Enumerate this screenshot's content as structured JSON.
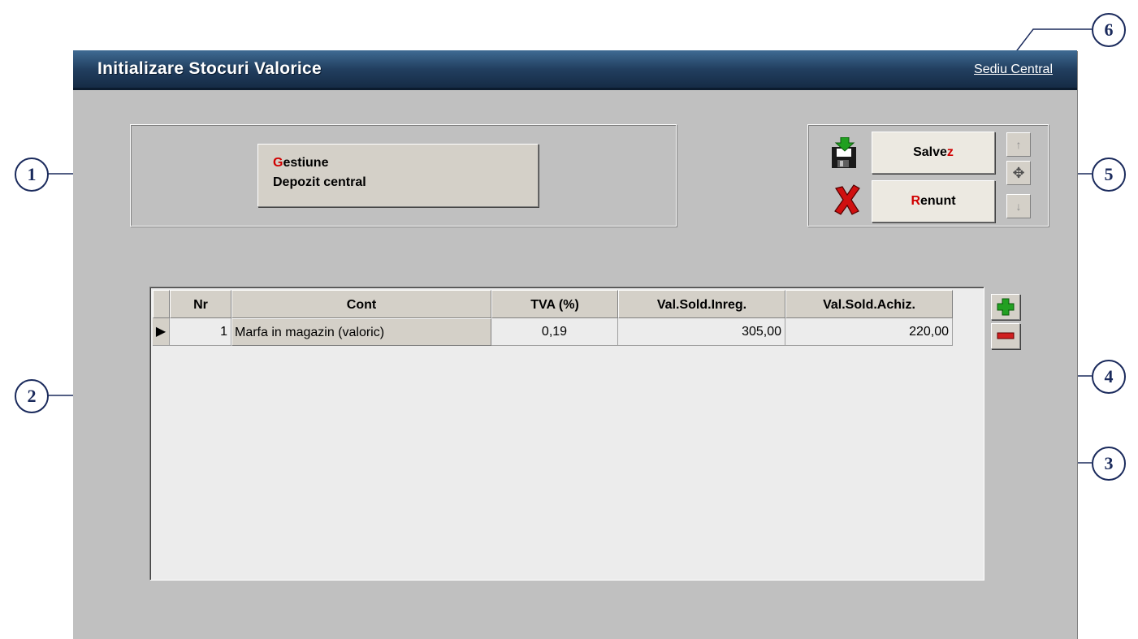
{
  "window": {
    "title": "Initializare Stocuri Valorice",
    "branch_link": "Sediu Central"
  },
  "gestiune": {
    "label_hotkey": "G",
    "label_rest": "estiune",
    "value": "Depozit central"
  },
  "actions": {
    "save": {
      "label_prefix": "Salve",
      "label_hotkey": "z"
    },
    "cancel": {
      "label_hotkey": "R",
      "label_rest": "enunt"
    },
    "up_icon": "arrow-up-icon",
    "move_icon": "move-icon",
    "down_icon": "arrow-down-icon"
  },
  "grid": {
    "columns": {
      "nr": "Nr",
      "cont": "Cont",
      "tva": "TVA (%)",
      "val_sold_inreg": "Val.Sold.Inreg.",
      "val_sold_achiz": "Val.Sold.Achiz."
    },
    "rows": [
      {
        "nr": "1",
        "cont": "Marfa in magazin (valoric)",
        "tva": "0,19",
        "val_sold_inreg": "305,00",
        "val_sold_achiz": "220,00"
      }
    ],
    "add_icon": "plus-icon",
    "delete_icon": "minus-icon"
  },
  "callouts": [
    "1",
    "2",
    "3",
    "4",
    "5",
    "6"
  ],
  "colors": {
    "titlebar": "#223f60",
    "form_bg": "#c0c0c0",
    "hotkey": "#d00000",
    "callout": "#1a2a5c"
  }
}
